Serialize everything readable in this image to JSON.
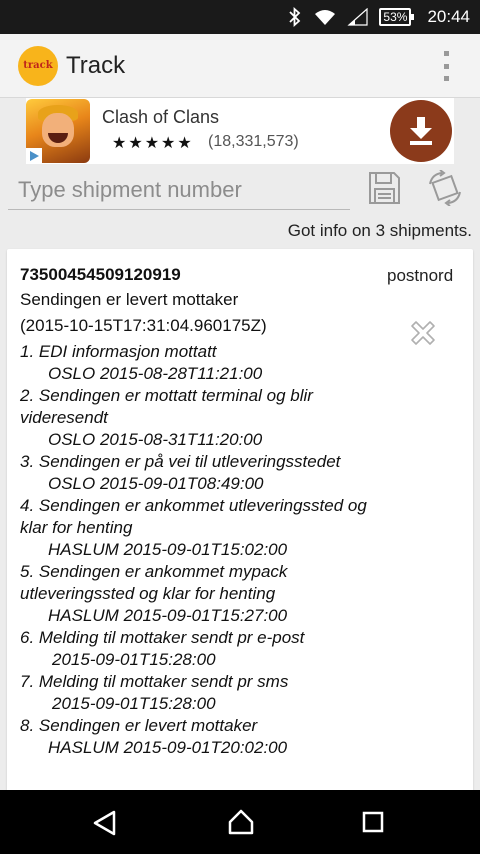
{
  "status_bar": {
    "battery": "53%",
    "time": "20:44"
  },
  "app_bar": {
    "logo_text": "track",
    "title": "Track"
  },
  "ad": {
    "app_name": "Clash of Clans",
    "stars": "★★★★★",
    "rating_count": "(18,331,573)"
  },
  "search": {
    "placeholder": "Type shipment number",
    "value": ""
  },
  "info_text": "Got info on 3 shipments.",
  "shipment": {
    "tracking_number": "73500454509120919",
    "status": "Sendingen er levert mottaker",
    "status_time": "(2015-10-15T17:31:04.960175Z)",
    "carrier": "postnord",
    "events": [
      {
        "title": "1. EDI informasjon mottatt",
        "lines": [
          "OSLO 2015-08-28T11:21:00"
        ]
      },
      {
        "title": "2. Sendingen er mottatt terminal og blir videresendt",
        "lines": [
          "OSLO 2015-08-31T11:20:00"
        ]
      },
      {
        "title": "3. Sendingen er på vei til utleveringsstedet",
        "lines": [
          "OSLO 2015-09-01T08:49:00"
        ]
      },
      {
        "title": "4. Sendingen er ankommet utleveringssted og klar for henting",
        "lines": [
          "HASLUM 2015-09-01T15:02:00"
        ]
      },
      {
        "title": "5. Sendingen er ankommet mypack utleveringssted og klar for henting",
        "lines": [
          "HASLUM 2015-09-01T15:27:00"
        ]
      },
      {
        "title": "6. Melding til mottaker sendt pr e-post",
        "lines": [
          "2015-09-01T15:28:00"
        ]
      },
      {
        "title": "7. Melding til mottaker sendt pr sms",
        "lines": [
          "2015-09-01T15:28:00"
        ]
      },
      {
        "title": "8. Sendingen er levert mottaker",
        "lines": [
          "HASLUM 2015-09-01T20:02:00"
        ]
      }
    ]
  },
  "colors": {
    "ad_download": "#8b3a1b",
    "logo": "#f8b41b",
    "status_bar": "#1a1a1a",
    "nav_bar": "#000000"
  }
}
